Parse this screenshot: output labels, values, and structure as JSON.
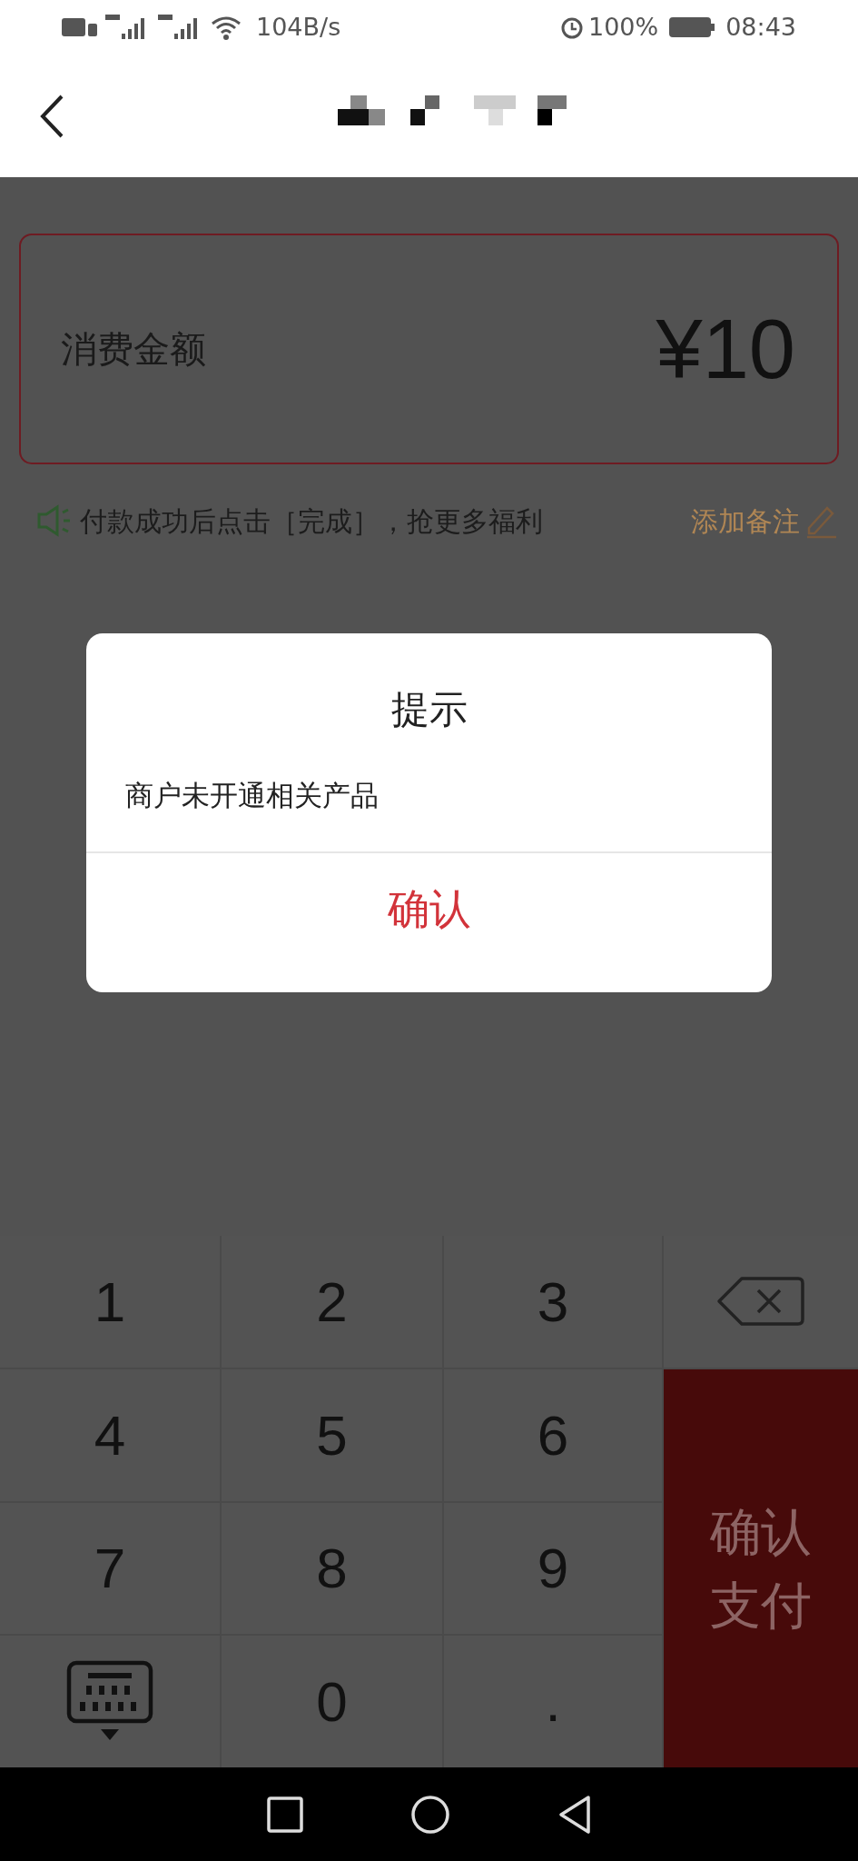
{
  "status_bar": {
    "network_speed": "104B/s",
    "battery": "100%",
    "time": "08:43"
  },
  "amount": {
    "label": "消费金额",
    "value": "¥10"
  },
  "hint": {
    "text": "付款成功后点击［完成］，抢更多福利",
    "action": "添加备注"
  },
  "dialog": {
    "title": "提示",
    "message": "商户未开通相关产品",
    "button": "确认"
  },
  "keypad": {
    "keys": [
      {
        "kind": "digit",
        "label": "1"
      },
      {
        "kind": "digit",
        "label": "2"
      },
      {
        "kind": "digit",
        "label": "3"
      },
      {
        "kind": "backspace"
      },
      {
        "kind": "digit",
        "label": "4"
      },
      {
        "kind": "digit",
        "label": "5"
      },
      {
        "kind": "digit",
        "label": "6"
      },
      {
        "kind": "digit",
        "label": "7"
      },
      {
        "kind": "digit",
        "label": "8"
      },
      {
        "kind": "digit",
        "label": "9"
      },
      {
        "kind": "hide"
      },
      {
        "kind": "digit",
        "label": "0"
      },
      {
        "kind": "digit",
        "label": "."
      }
    ],
    "confirm": "确认支付"
  }
}
